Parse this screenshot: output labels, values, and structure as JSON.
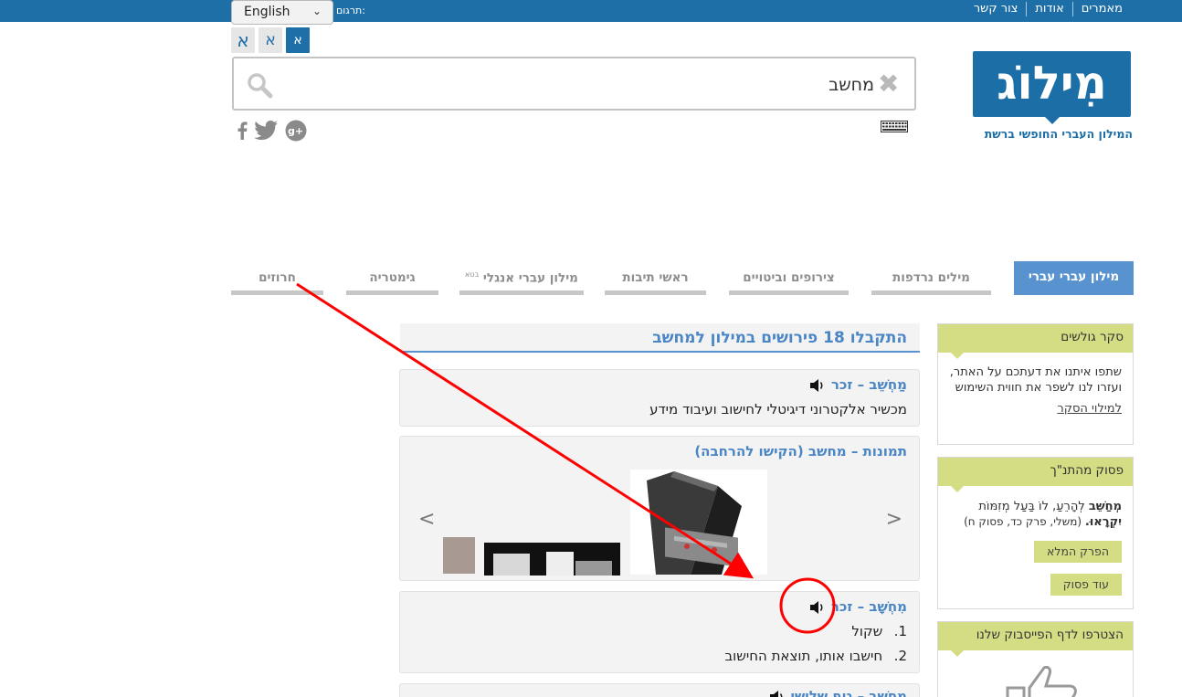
{
  "topbar": {
    "links": [
      "מאמרים",
      "אודות",
      "צור קשר"
    ],
    "translate_label": "תרגום:",
    "language": "English"
  },
  "font_size_buttons": [
    "א",
    "א",
    "א"
  ],
  "search": {
    "value": "מחשב"
  },
  "logo": {
    "text": "מִילוֹג",
    "tagline": "המילון העברי החופשי ברשת"
  },
  "tabs": [
    "מילון עברי עברי",
    "מילים נרדפות",
    "צירופים וביטויים",
    "ראשי תיבות",
    "מילון עברי אנגלי",
    "גימטריה",
    "חרוזים"
  ],
  "beta_tag": "בטא",
  "sidebar": {
    "survey": {
      "title": "סקר גולשים",
      "text": "שתפו איתנו את דעתכם על האתר, ועזרו לנו לשפר את חווית השימוש",
      "link": "למילוי הסקר"
    },
    "verse": {
      "title": "פסוק מהתנ\"ך",
      "verse_bold": "מְחַשֵּׁב",
      "verse_text": " לְהָרֵעַ, לוֹ בַּעַל מְזִמּוֹת ",
      "verse_end": "יִקְרָאוּ.",
      "source": " (משלי, פרק כד, פסוק ח)",
      "btn_chapter": "הפרק המלא",
      "btn_more": "עוד פסוק"
    },
    "facebook": {
      "title": "הצטרפו לדף הפייסבוק שלנו"
    }
  },
  "results": {
    "title": "התקבלו 18 פירושים במילון למחשב",
    "entries": [
      {
        "title": "מַחְשֵׁב – זכר",
        "defs": [
          "מכשיר אלקטרוני דיגיטלי לחישוב ועיבוד מידע"
        ]
      },
      {
        "title": "מִחְשָׁב – זכר",
        "defs": [
          "שקול",
          "חישבו אותו, תוצאת החישוב"
        ]
      },
      {
        "title": "מַחְשֵׁב – גוף שלישי"
      }
    ],
    "images_title": "תמונות – מחשב (הקישו להרחבה)",
    "def_numbers": [
      "1.",
      "2."
    ],
    "prev": "<",
    "next": ">"
  },
  "colors": {
    "primary": "#1e6fa8",
    "accent": "#5993cf",
    "sidebar_head": "#d4dc84",
    "annotation": "#ff0000"
  }
}
